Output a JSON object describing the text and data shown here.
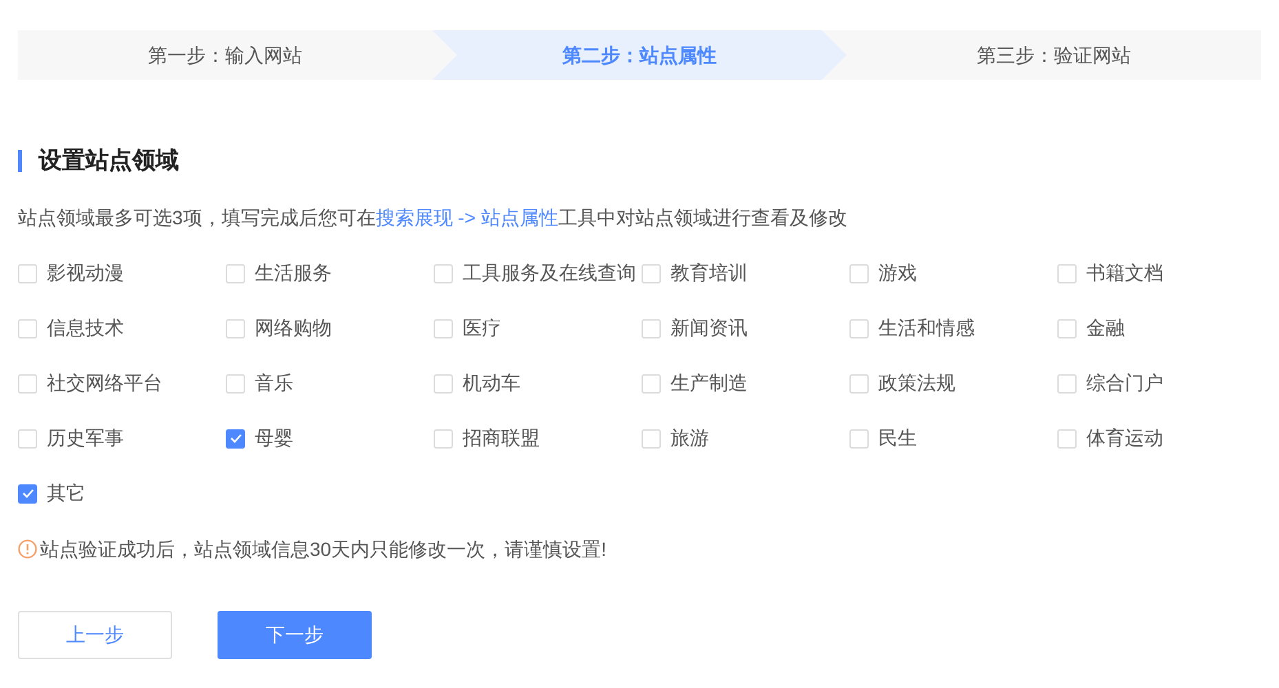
{
  "steps": [
    {
      "label": "第一步：输入网站",
      "selected": false
    },
    {
      "label": "第二步：站点属性",
      "selected": true
    },
    {
      "label": "第三步：验证网站",
      "selected": false
    }
  ],
  "section_title": "设置站点领域",
  "description": {
    "before": "站点领域最多可选3项，填写完成后您可在",
    "link": "搜索展现 -> 站点属性",
    "after": "工具中对站点领域进行查看及修改"
  },
  "options": [
    {
      "label": "影视动漫",
      "checked": false
    },
    {
      "label": "生活服务",
      "checked": false
    },
    {
      "label": "工具服务及在线查询",
      "checked": false
    },
    {
      "label": "教育培训",
      "checked": false
    },
    {
      "label": "游戏",
      "checked": false
    },
    {
      "label": "书籍文档",
      "checked": false
    },
    {
      "label": "信息技术",
      "checked": false
    },
    {
      "label": "网络购物",
      "checked": false
    },
    {
      "label": "医疗",
      "checked": false
    },
    {
      "label": "新闻资讯",
      "checked": false
    },
    {
      "label": "生活和情感",
      "checked": false
    },
    {
      "label": "金融",
      "checked": false
    },
    {
      "label": "社交网络平台",
      "checked": false
    },
    {
      "label": "音乐",
      "checked": false
    },
    {
      "label": "机动车",
      "checked": false
    },
    {
      "label": "生产制造",
      "checked": false
    },
    {
      "label": "政策法规",
      "checked": false
    },
    {
      "label": "综合门户",
      "checked": false
    },
    {
      "label": "历史军事",
      "checked": false
    },
    {
      "label": "母婴",
      "checked": true
    },
    {
      "label": "招商联盟",
      "checked": false
    },
    {
      "label": "旅游",
      "checked": false
    },
    {
      "label": "民生",
      "checked": false
    },
    {
      "label": "体育运动",
      "checked": false
    },
    {
      "label": "其它",
      "checked": true
    }
  ],
  "warning": "站点验证成功后，站点领域信息30天内只能修改一次，请谨慎设置!",
  "buttons": [
    {
      "label": "上一步",
      "kind": "secondary"
    },
    {
      "label": "下一步",
      "kind": "primary"
    }
  ]
}
